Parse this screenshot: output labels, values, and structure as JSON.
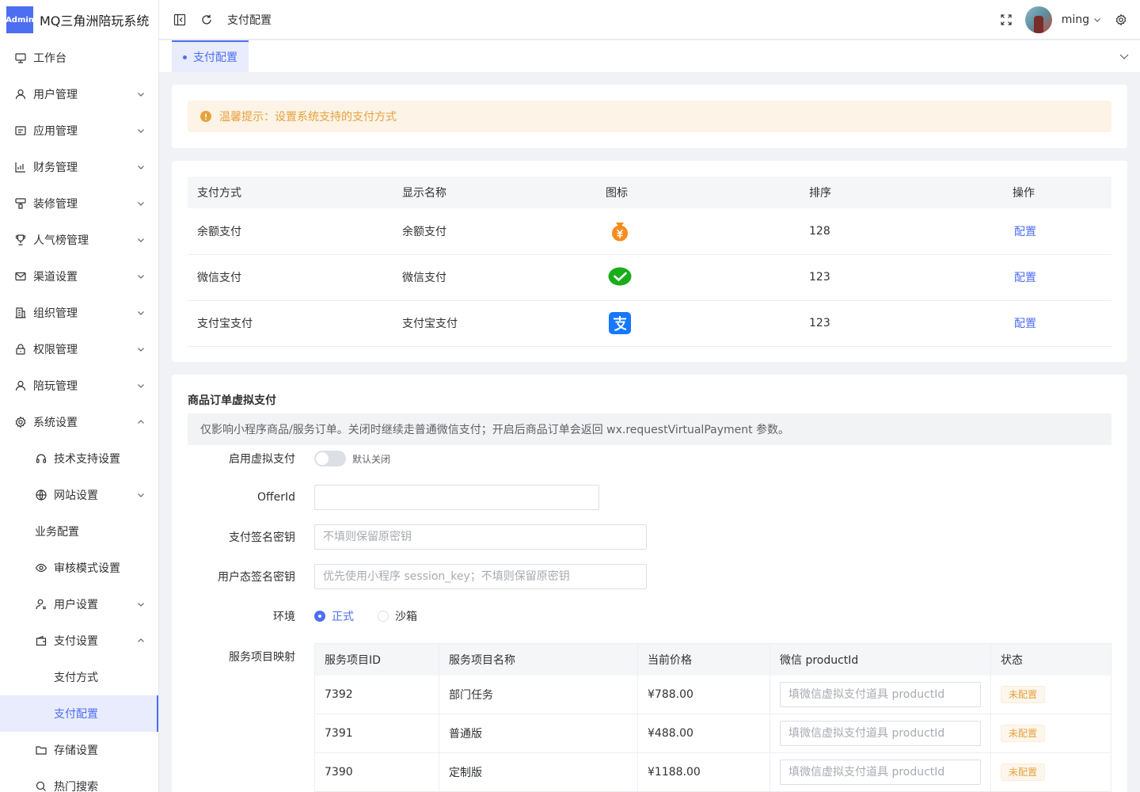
{
  "app": {
    "badge": "Admin",
    "title": "MQ三角洲陪玩系统"
  },
  "header": {
    "breadcrumb": "支付配置",
    "user_name": "ming"
  },
  "tabs": [
    {
      "label": "支付配置"
    }
  ],
  "sidebar": {
    "items": [
      {
        "label": "工作台"
      },
      {
        "label": "用户管理"
      },
      {
        "label": "应用管理"
      },
      {
        "label": "财务管理"
      },
      {
        "label": "装修管理"
      },
      {
        "label": "人气榜管理"
      },
      {
        "label": "渠道设置"
      },
      {
        "label": "组织管理"
      },
      {
        "label": "权限管理"
      },
      {
        "label": "陪玩管理"
      },
      {
        "label": "系统设置"
      },
      {
        "label": "技术支持设置"
      },
      {
        "label": "网站设置"
      },
      {
        "label": "业务配置"
      },
      {
        "label": "审核模式设置"
      },
      {
        "label": "用户设置"
      },
      {
        "label": "支付设置"
      },
      {
        "label": "支付方式"
      },
      {
        "label": "支付配置"
      },
      {
        "label": "存储设置"
      },
      {
        "label": "热门搜索"
      }
    ]
  },
  "alert": {
    "text": "温馨提示：设置系统支持的支付方式"
  },
  "pay_table": {
    "headers": [
      "支付方式",
      "显示名称",
      "图标",
      "排序",
      "操作"
    ],
    "rows": [
      {
        "method": "余额支付",
        "name": "余额支付",
        "icon": "balance-icon",
        "sort": "128",
        "action": "配置"
      },
      {
        "method": "微信支付",
        "name": "微信支付",
        "icon": "wechat-icon",
        "sort": "123",
        "action": "配置"
      },
      {
        "method": "支付宝支付",
        "name": "支付宝支付",
        "icon": "alipay-icon",
        "sort": "123",
        "action": "配置"
      }
    ]
  },
  "virtual": {
    "title": "商品订单虚拟支付",
    "desc": "仅影响小程序商品/服务订单。关闭时继续走普通微信支付；开启后商品订单会返回 wx.requestVirtualPayment 参数。",
    "enable_label": "启用虚拟支付",
    "enable_tip": "默认关闭",
    "enabled": false,
    "offer_label": "OfferId",
    "offer_value": "",
    "sign_label": "支付签名密钥",
    "sign_placeholder": "不填则保留原密钥",
    "user_sign_label": "用户态签名密钥",
    "user_sign_placeholder": "优先使用小程序 session_key；不填则保留原密钥",
    "env_label": "环境",
    "env_options": [
      "正式",
      "沙箱"
    ],
    "env_selected": "正式",
    "mapping_label": "服务项目映射",
    "mapping_headers": [
      "服务项目ID",
      "服务项目名称",
      "当前价格",
      "微信 productId",
      "状态"
    ],
    "mapping_rows": [
      {
        "id": "7392",
        "name": "部门任务",
        "price": "¥788.00",
        "product_placeholder": "填微信虚拟支付道具 productId",
        "status": "未配置"
      },
      {
        "id": "7391",
        "name": "普通版",
        "price": "¥488.00",
        "product_placeholder": "填微信虚拟支付道具 productId",
        "status": "未配置"
      },
      {
        "id": "7390",
        "name": "定制版",
        "price": "¥1188.00",
        "product_placeholder": "填微信虚拟支付道具 productId",
        "status": "未配置"
      }
    ]
  },
  "colors": {
    "primary": "#4e6ef2",
    "warning": "#e6a23c"
  }
}
